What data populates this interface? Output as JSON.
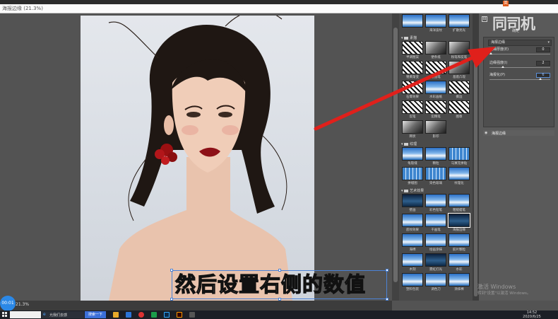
{
  "window": {
    "doc_title": "海报边缘 (21.3%)"
  },
  "canvas": {
    "zoom": "21.3%"
  },
  "record_badge": "00:01",
  "subtitle": "然后设置右侧的数值",
  "gallery": {
    "top_row": [
      {
        "label": "",
        "style": "sky"
      },
      {
        "label": "海洋波纹",
        "style": "sky"
      },
      {
        "label": "扩散亮光",
        "style": "sky"
      }
    ],
    "categories": [
      {
        "name": "素描",
        "items": [
          {
            "label": "半调图案",
            "style": "bw"
          },
          {
            "label": "便条纸",
            "style": "gray"
          },
          {
            "label": "粉笔和炭笔",
            "style": "gray"
          },
          {
            "label": "铬黄渐变",
            "style": "bw"
          },
          {
            "label": "绘图笔",
            "style": "bw"
          },
          {
            "label": "基底凸现",
            "style": "gray"
          },
          {
            "label": "石膏效果",
            "style": "bw"
          },
          {
            "label": "水彩画纸",
            "style": "sky"
          },
          {
            "label": "撕边",
            "style": "bw"
          },
          {
            "label": "炭笔",
            "style": "bw"
          },
          {
            "label": "炭精笔",
            "style": "bw"
          },
          {
            "label": "图章",
            "style": "bw"
          },
          {
            "label": "网状",
            "style": "gray"
          },
          {
            "label": "影印",
            "style": "gray"
          }
        ]
      },
      {
        "name": "纹理",
        "items": [
          {
            "label": "龟裂缝",
            "style": "sky"
          },
          {
            "label": "颗粒",
            "style": "sky"
          },
          {
            "label": "马赛克拼贴",
            "style": "tile"
          },
          {
            "label": "拼缀图",
            "style": "tile"
          },
          {
            "label": "染色玻璃",
            "style": "tile"
          },
          {
            "label": "纹理化",
            "style": "sky"
          }
        ]
      },
      {
        "name": "艺术效果",
        "items": [
          {
            "label": "壁画",
            "style": "dark"
          },
          {
            "label": "彩色铅笔",
            "style": "sky"
          },
          {
            "label": "粗糙蜡笔",
            "style": "sky"
          },
          {
            "label": "底纹效果",
            "style": "sky"
          },
          {
            "label": "干画笔",
            "style": "sky"
          },
          {
            "label": "海报边缘",
            "style": "dark"
          },
          {
            "label": "海绵",
            "style": "sky"
          },
          {
            "label": "绘画涂抹",
            "style": "sky"
          },
          {
            "label": "胶片颗粒",
            "style": "sky"
          },
          {
            "label": "木刻",
            "style": "sky"
          },
          {
            "label": "霓虹灯光",
            "style": "dark"
          },
          {
            "label": "水彩",
            "style": "sky"
          },
          {
            "label": "塑料包装",
            "style": "sky"
          },
          {
            "label": "调色刀",
            "style": "sky"
          },
          {
            "label": "涂抹棒",
            "style": "sky"
          }
        ]
      }
    ]
  },
  "right_panel": {
    "collapse_icon": "⊟",
    "watermark": "同司机",
    "watermark_sub": "确定",
    "filter_select": "海报边缘",
    "params": [
      {
        "label": "边缘厚度(E)",
        "value": "0",
        "fraction": 0.0
      },
      {
        "label": "边缘强度(I)",
        "value": "2",
        "fraction": 0.2
      },
      {
        "label": "海报化(P)",
        "value": "6",
        "fraction": 0.83
      }
    ],
    "layer_name": "海报边缘",
    "activate_title": "激活 Windows",
    "activate_sub": "转到\"设置\"以激活 Windows。"
  },
  "taskbar": {
    "search_label": "",
    "browser_label": "允我们去感",
    "button_label": "搜索一下",
    "ime": "英",
    "time": "14:52",
    "date": "2020/6/25"
  },
  "colors": {
    "arrow": "#e0201b",
    "accent": "#4b82d6"
  }
}
